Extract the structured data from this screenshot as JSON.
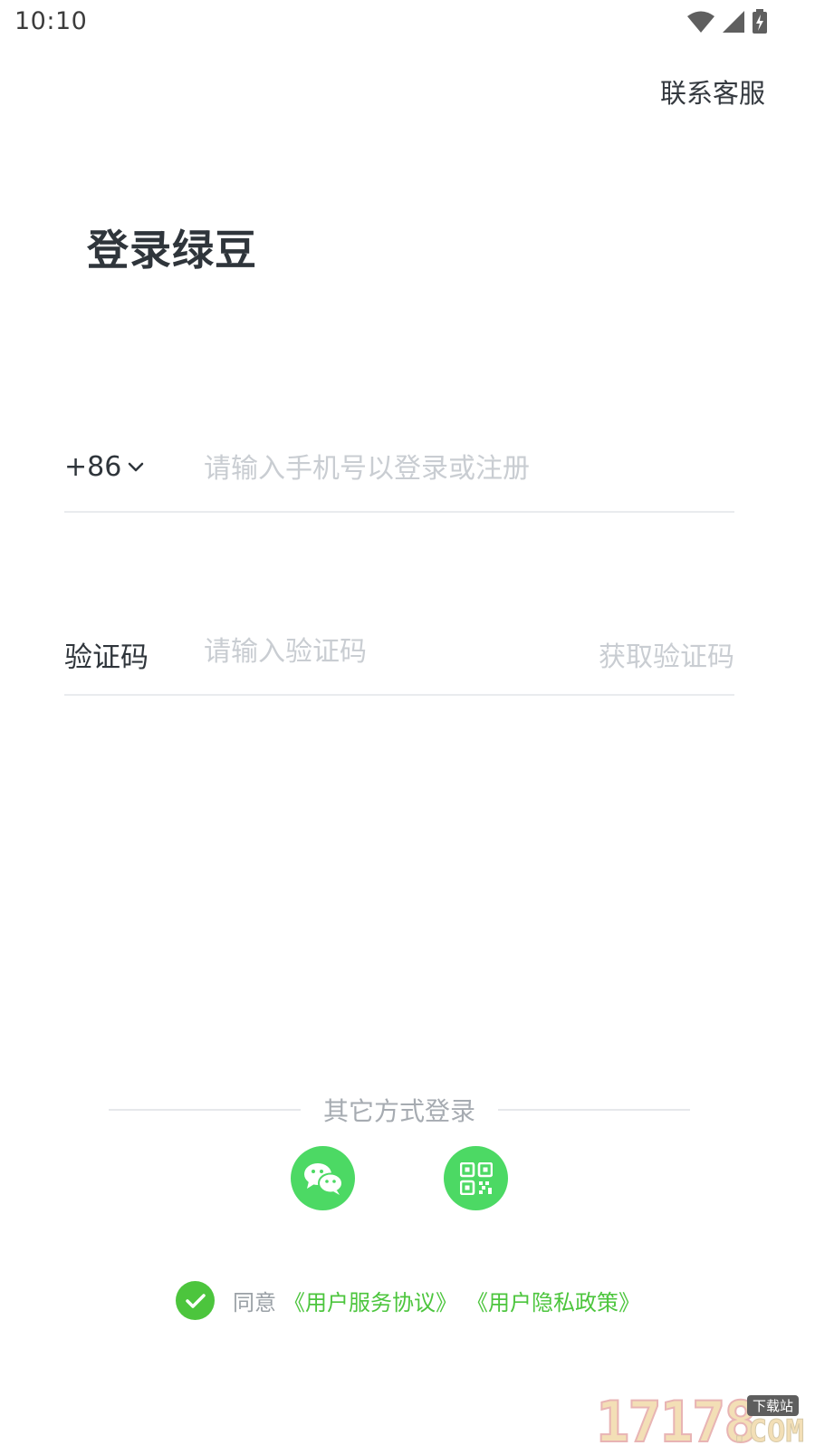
{
  "status_bar": {
    "time": "10:10",
    "icons": [
      "wifi-icon",
      "cellular-signal-icon",
      "battery-charging-icon"
    ]
  },
  "header": {
    "contact_label": "联系客服"
  },
  "title": "登录绿豆",
  "phone_field": {
    "country_code": "+86",
    "placeholder": "请输入手机号以登录或注册",
    "value": ""
  },
  "code_field": {
    "label": "验证码",
    "placeholder": "请输入验证码",
    "value": "",
    "get_code_label": "获取验证码"
  },
  "other_login": {
    "label": "其它方式登录",
    "methods": [
      "wechat-icon",
      "qr-code-icon"
    ]
  },
  "agreement": {
    "checked": true,
    "prefix": "同意",
    "terms_label": "《用户服务协议》",
    "privacy_label": "《用户隐私政策》"
  },
  "watermark": {
    "number": "17178",
    "badge": "下载站",
    "suffix": ".COM"
  },
  "colors": {
    "accent_green": "#4cd964",
    "link_green": "#4cc53d",
    "title_text": "#2f353b",
    "placeholder_text": "#c9cdd2",
    "divider": "#e9ebee"
  }
}
